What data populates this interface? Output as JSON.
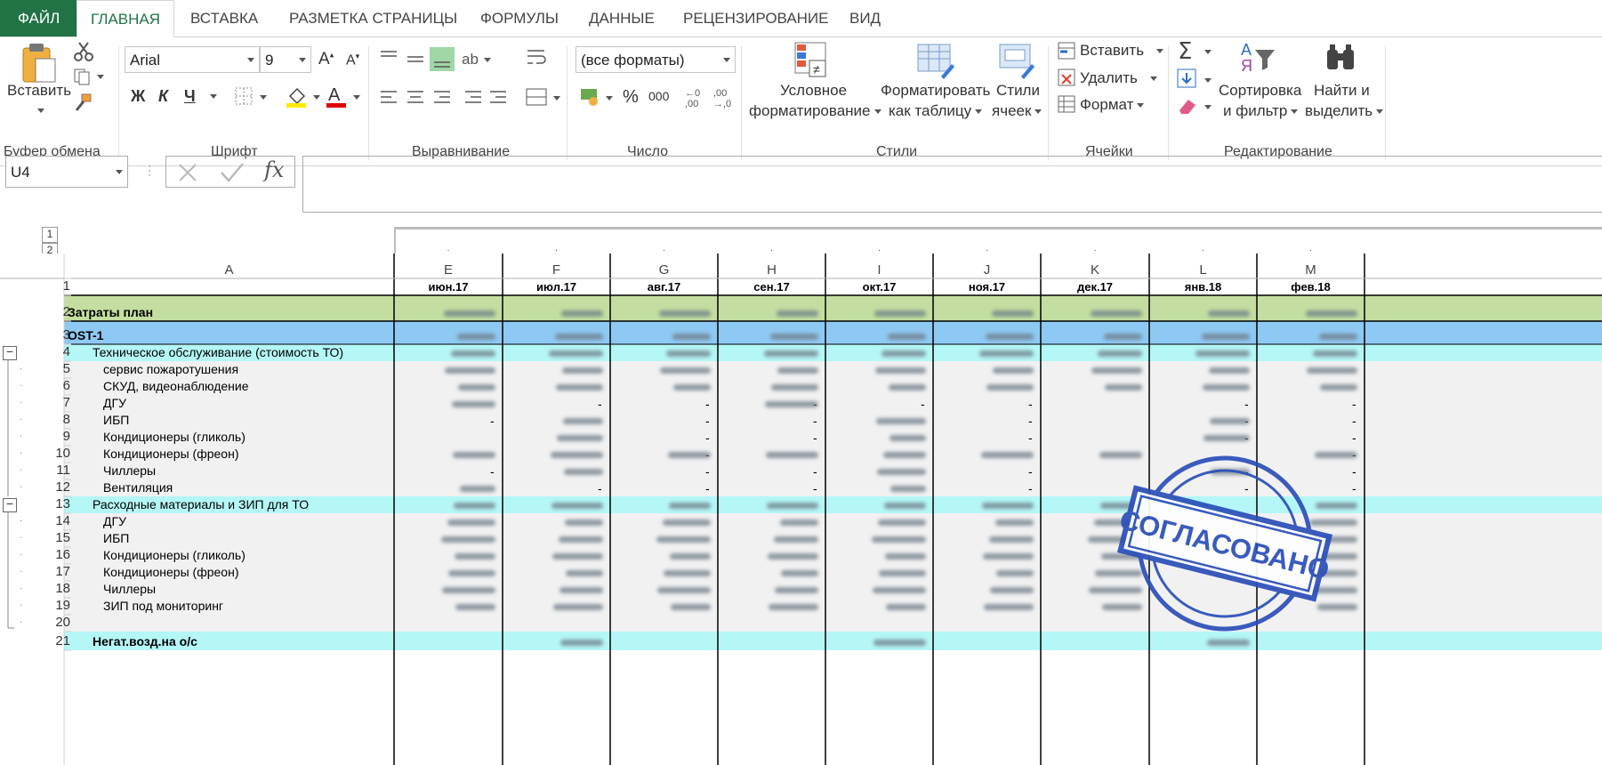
{
  "tabs": {
    "file": "ФАЙЛ",
    "items": [
      "ГЛАВНАЯ",
      "ВСТАВКА",
      "РАЗМЕТКА СТРАНИЦЫ",
      "ФОРМУЛЫ",
      "ДАННЫЕ",
      "РЕЦЕНЗИРОВАНИЕ",
      "ВИД"
    ]
  },
  "ribbon": {
    "paste": "Вставить",
    "clipboard": "Буфер обмена",
    "font_name": "Arial",
    "font_size": "9",
    "bold": "Ж",
    "italic": "К",
    "underline": "Ч",
    "font_group": "Шрифт",
    "align_group": "Выравнивание",
    "number_format": "(все форматы)",
    "percent": "%",
    "thousands": "000",
    "number_group": "Число",
    "cond_format_1": "Условное",
    "cond_format_2": "форматирование",
    "format_table_1": "Форматировать",
    "format_table_2": "как таблицу",
    "cell_styles_1": "Стили",
    "cell_styles_2": "ячеек",
    "styles_group": "Стили",
    "insert": "Вставить",
    "delete": "Удалить",
    "format": "Формат",
    "cells_group": "Ячейки",
    "sort_1": "Сортировка",
    "sort_2": "и фильтр",
    "find_1": "Найти и",
    "find_2": "выделить",
    "editing_group": "Редактирование"
  },
  "formula_bar": {
    "name_box": "U4",
    "fx": "fx",
    "formula": ""
  },
  "sheet": {
    "outline_levels": [
      "1",
      "2"
    ],
    "columns": [
      "A",
      "E",
      "F",
      "G",
      "H",
      "I",
      "J",
      "K",
      "L",
      "M"
    ],
    "months": [
      "июн.17",
      "июл.17",
      "авг.17",
      "сен.17",
      "окт.17",
      "ноя.17",
      "дек.17",
      "янв.18",
      "фев.18"
    ],
    "rows": [
      {
        "n": "1",
        "label": ""
      },
      {
        "n": "2",
        "label": "Затраты план"
      },
      {
        "n": "3",
        "label": "OST-1"
      },
      {
        "n": "4",
        "label": "Техническое обслуживание (стоимость ТО)"
      },
      {
        "n": "5",
        "label": "сервис пожаротушения"
      },
      {
        "n": "6",
        "label": "СКУД, видеонаблюдение"
      },
      {
        "n": "7",
        "label": "ДГУ"
      },
      {
        "n": "8",
        "label": "ИБП"
      },
      {
        "n": "9",
        "label": "Кондиционеры (гликоль)"
      },
      {
        "n": "10",
        "label": "Кондиционеры (фреон)"
      },
      {
        "n": "11",
        "label": "Чиллеры"
      },
      {
        "n": "12",
        "label": "Вентиляция"
      },
      {
        "n": "13",
        "label": "Расходные материалы и ЗИП для ТО"
      },
      {
        "n": "14",
        "label": "ДГУ"
      },
      {
        "n": "15",
        "label": "ИБП"
      },
      {
        "n": "16",
        "label": "Кондиционеры (гликоль)"
      },
      {
        "n": "17",
        "label": "Кондиционеры (фреон)"
      },
      {
        "n": "18",
        "label": "Чиллеры"
      },
      {
        "n": "19",
        "label": "ЗИП под мониторинг"
      },
      {
        "n": "20",
        "label": ""
      },
      {
        "n": "21",
        "label": "Негат.возд.на о/с"
      }
    ],
    "dash": "-"
  },
  "stamp": "СОГЛАСОВАНО",
  "colors": {
    "excel_green": "#217346",
    "row2_fill": "#c3dea0",
    "row3_fill": "#8ec9f3",
    "cyan_fill": "#b5f7f7",
    "stamp_blue": "#2b4fb8"
  }
}
